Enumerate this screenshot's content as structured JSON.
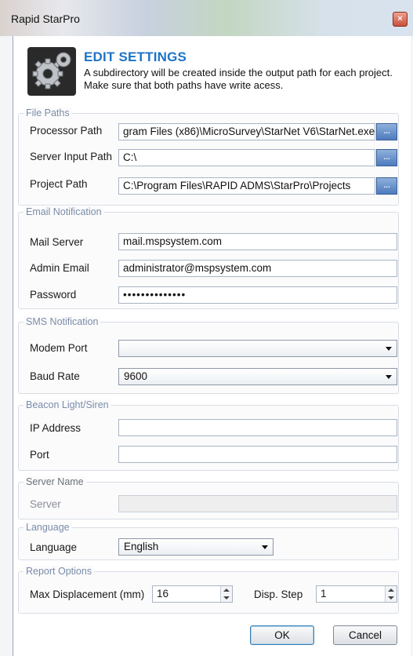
{
  "window": {
    "title": "Rapid StarPro",
    "close_glyph": "×"
  },
  "header": {
    "title": "EDIT SETTINGS",
    "description": "A subdirectory will be created inside the output path for each project. Make sure that both paths have write acess.",
    "icon": "gears-icon"
  },
  "file_paths": {
    "legend": "File Paths",
    "processor_label": "Processor Path",
    "processor_value": "gram Files (x86)\\MicroSurvey\\StarNet V6\\StarNet.exe",
    "server_input_label": "Server Input Path",
    "server_input_value": "C:\\",
    "project_label": "Project Path",
    "project_value": "C:\\Program Files\\RAPID ADMS\\StarPro\\Projects",
    "browse_label": "..."
  },
  "email": {
    "legend": "Email Notification",
    "mail_server_label": "Mail Server",
    "mail_server_value": "mail.mspsystem.com",
    "admin_email_label": "Admin Email",
    "admin_email_value": "administrator@mspsystem.com",
    "password_label": "Password",
    "password_value": "••••••••••••••"
  },
  "sms": {
    "legend": "SMS Notification",
    "modem_port_label": "Modem Port",
    "modem_port_value": "",
    "baud_rate_label": "Baud Rate",
    "baud_rate_value": "9600"
  },
  "beacon": {
    "legend": "Beacon Light/Siren",
    "ip_label": "IP Address",
    "ip_value": "",
    "port_label": "Port",
    "port_value": ""
  },
  "server_name": {
    "legend": "Server Name",
    "server_label": "Server",
    "server_value": ""
  },
  "language": {
    "legend": "Language",
    "label": "Language",
    "value": "English"
  },
  "report": {
    "legend": "Report Options",
    "max_disp_label": "Max Displacement (mm)",
    "max_disp_value": "16",
    "disp_step_label": "Disp. Step",
    "disp_step_value": "1"
  },
  "buttons": {
    "ok": "OK",
    "cancel": "Cancel"
  }
}
